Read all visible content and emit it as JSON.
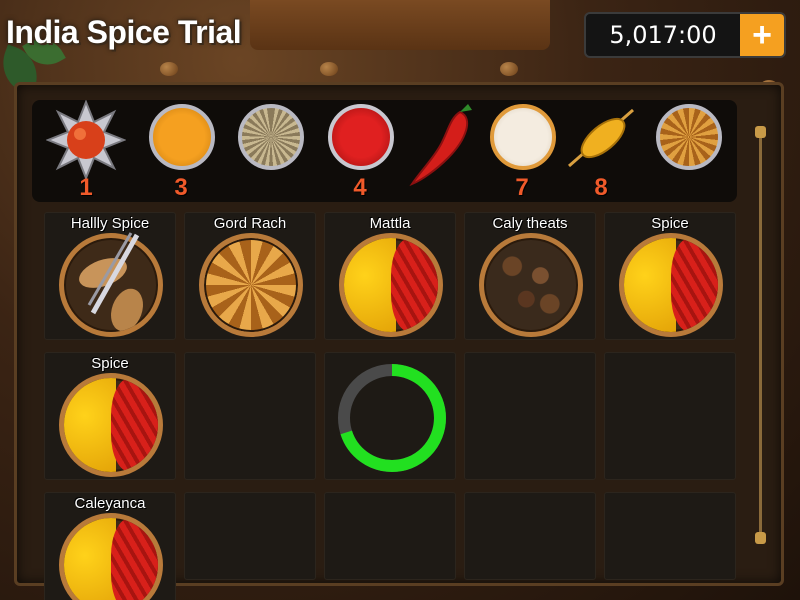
{
  "header": {
    "title": "India Spice Trial",
    "currency_value": "5,017:00",
    "add_label": "+"
  },
  "ingredients": [
    {
      "icon": "tomato-star-icon",
      "number": "1"
    },
    {
      "icon": "turmeric-bowl-icon",
      "number": "3"
    },
    {
      "icon": "fennel-bowl-icon",
      "number": ""
    },
    {
      "icon": "red-seed-bowl-icon",
      "number": "4"
    },
    {
      "icon": "red-chili-icon",
      "number": ""
    },
    {
      "icon": "salt-bowl-icon",
      "number": "7"
    },
    {
      "icon": "saffron-pod-icon",
      "number": "8"
    },
    {
      "icon": "star-anise-bowl-icon",
      "number": ""
    }
  ],
  "grid": {
    "row1": [
      {
        "label": "Hallly Spice",
        "icon": "leaf-spice-plate-icon"
      },
      {
        "label": "Gord Rach",
        "icon": "star-anise-plate-icon"
      },
      {
        "label": "Mattla",
        "icon": "masala-plate-icon"
      },
      {
        "label": "Caly theats",
        "icon": "cardamom-plate-icon"
      },
      {
        "label": "Spice",
        "icon": "masala-plate-icon"
      }
    ],
    "row2": [
      {
        "label": "Spice",
        "icon": "masala-plate-icon"
      }
    ],
    "row3": [
      {
        "label": "Caleyanca",
        "icon": "masala-plate-icon"
      }
    ]
  },
  "progress": {
    "fraction": 0.7
  },
  "colors": {
    "accent_orange": "#f5a020",
    "number_red": "#f05a2a",
    "progress_green": "#22e020",
    "progress_track": "#4a4a4a"
  }
}
